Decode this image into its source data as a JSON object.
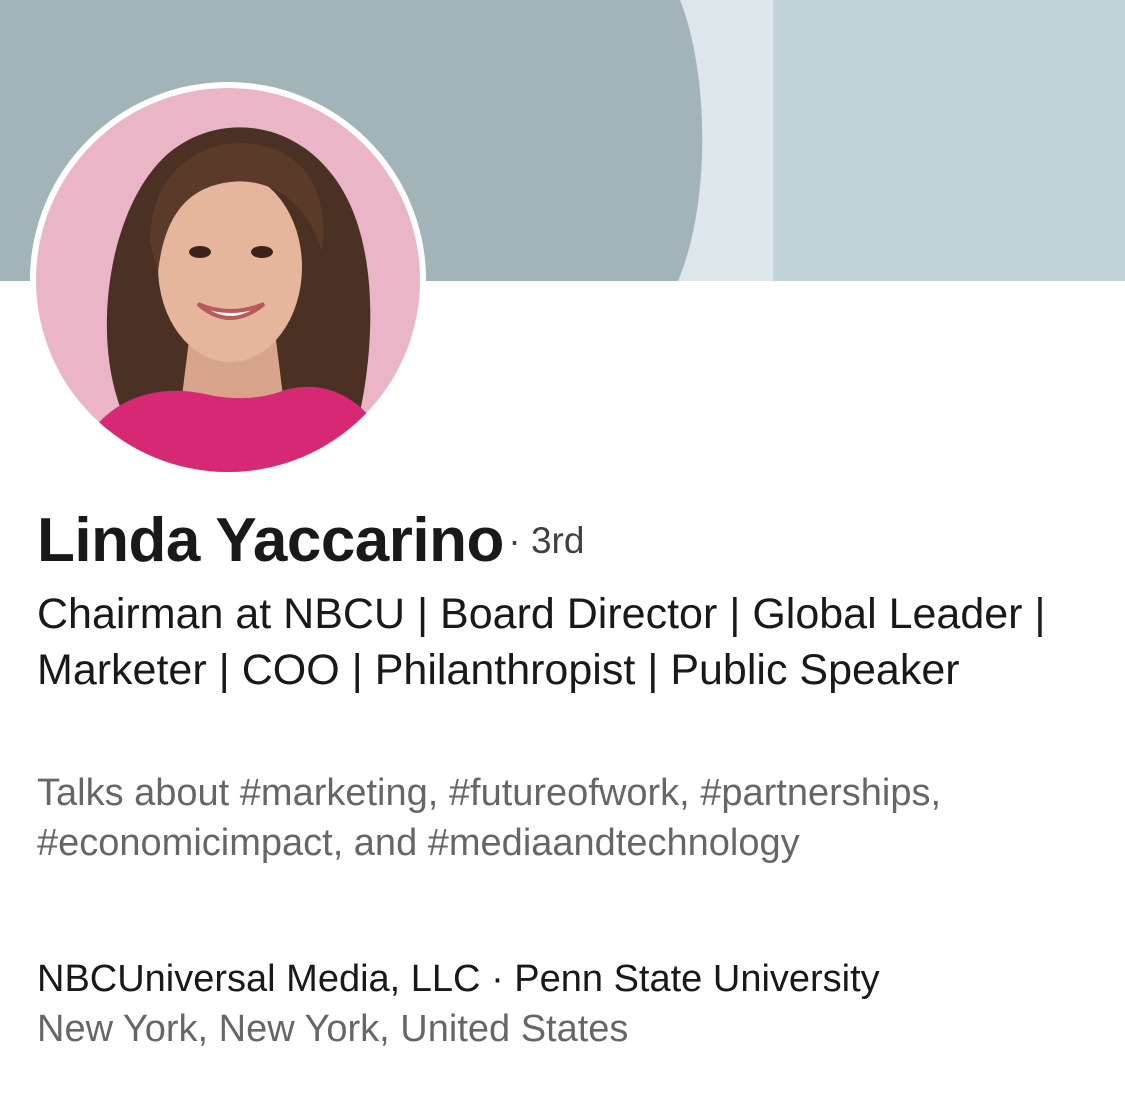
{
  "profile": {
    "name": "Linda Yaccarino",
    "degree": "· 3rd",
    "headline": "Chairman at NBCU | Board Director | Global Leader | Marketer | COO | Philanthropist | Public Speaker",
    "talks_about": "Talks about #marketing, #futureofwork, #partnerships, #economicimpact, and #mediaandtechnology",
    "company": "NBCUniversal Media, LLC",
    "separator": "·",
    "education": "Penn State University",
    "location": "New York, New York, United States"
  },
  "colors": {
    "banner_dark": "#a2b4b9",
    "banner_light": "#dde6ea",
    "banner_right": "#c1d2d8",
    "avatar_bg": "#eab6c7",
    "outfit": "#d72873"
  },
  "icons": {
    "avatar": "profile-photo"
  }
}
